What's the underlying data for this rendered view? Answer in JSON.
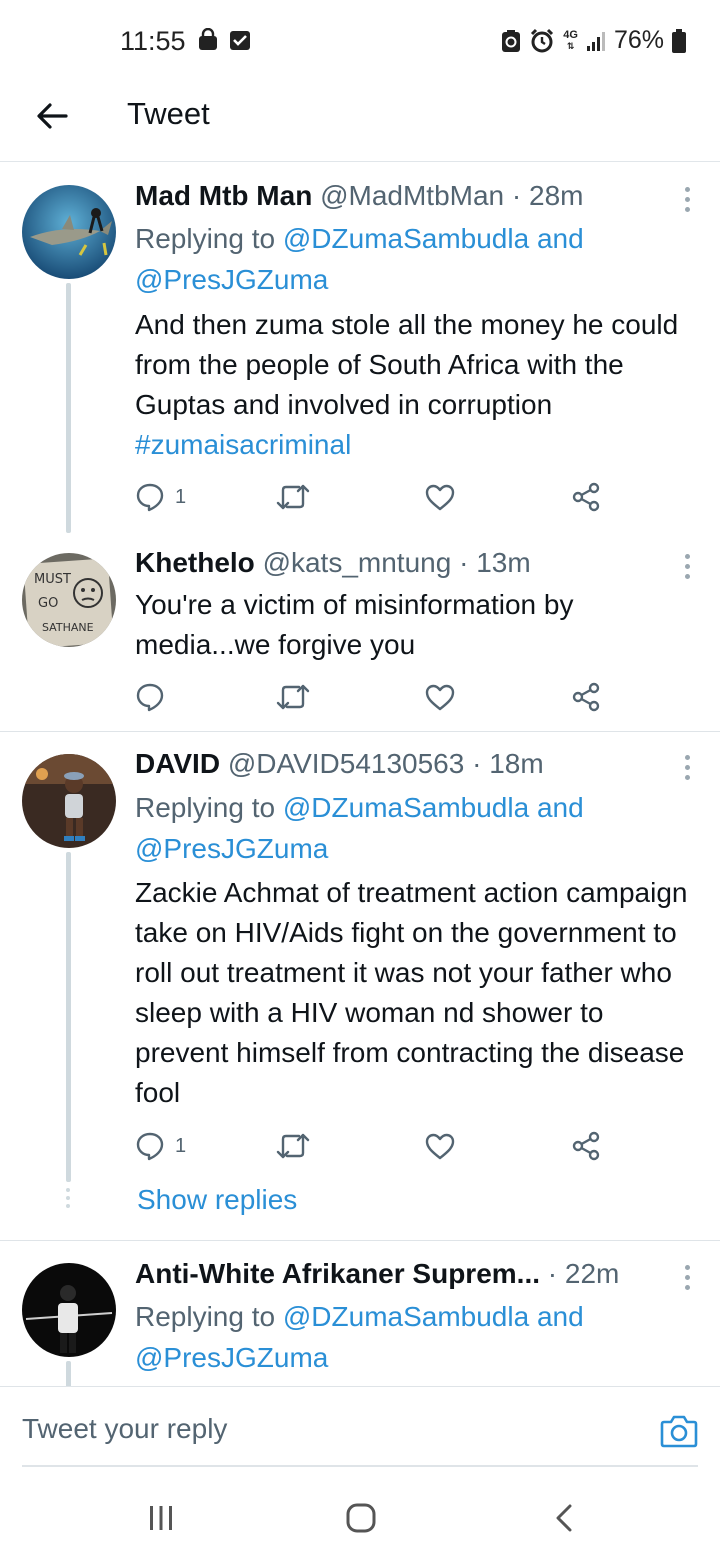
{
  "status_bar": {
    "time": "11:55",
    "network": "4G",
    "battery": "76%",
    "icons": [
      "bag-icon",
      "check-box-icon",
      "battery-saver-icon",
      "alarm-icon",
      "signal-icon",
      "battery-icon"
    ]
  },
  "header": {
    "title": "Tweet",
    "back_icon": "arrow-left-icon"
  },
  "tweets": [
    {
      "name": "Mad Mtb Man",
      "handle": "@MadMtbMan",
      "dot": "·",
      "time": "28m",
      "replying_prefix": "Replying to",
      "replying_to_1": "@DZumaSambudla",
      "replying_and": "and",
      "replying_to_2": "@PresJGZuma",
      "body": "And then zuma stole all the money he could from the people of South Africa with the Guptas and involved in corruption ",
      "hashtag": "#zumaisacriminal",
      "reply_count": "1"
    },
    {
      "name": "Khethelo",
      "handle": "@kats_mntung",
      "dot": "·",
      "time": "13m",
      "body": "You're a victim of misinformation by media...we forgive you",
      "reply_count": "",
      "avatar_text": [
        "MUST",
        "GO",
        "SATHANE"
      ]
    },
    {
      "name": "DAVID",
      "handle": "@DAVID54130563",
      "dot": "·",
      "time": "18m",
      "replying_prefix": "Replying to",
      "replying_to_1": "@DZumaSambudla",
      "replying_and": "and",
      "replying_to_2": "@PresJGZuma",
      "body": "Zackie Achmat of treatment action campaign take on HIV/Aids fight on the government to roll out treatment it was not your father who sleep with a HIV woman nd shower to prevent himself from contracting the disease fool",
      "reply_count": "1",
      "show_replies": "Show replies"
    },
    {
      "name": "Anti-White Afrikaner Suprem...",
      "handle": "",
      "dot": "·",
      "time": "22m",
      "replying_prefix": "Replying to",
      "replying_to_1": "@DZumaSambudla",
      "replying_and": "and",
      "replying_to_2": "@PresJGZuma"
    }
  ],
  "reply_bar": {
    "placeholder": "Tweet your reply",
    "camera_icon": "camera-icon"
  },
  "nav_bar": {
    "icons": [
      "recents-icon",
      "home-icon",
      "back-icon"
    ]
  },
  "colors": {
    "link": "#2a8fd6",
    "muted": "#536471",
    "text": "#0f1419",
    "divider": "#dfe4e8"
  }
}
